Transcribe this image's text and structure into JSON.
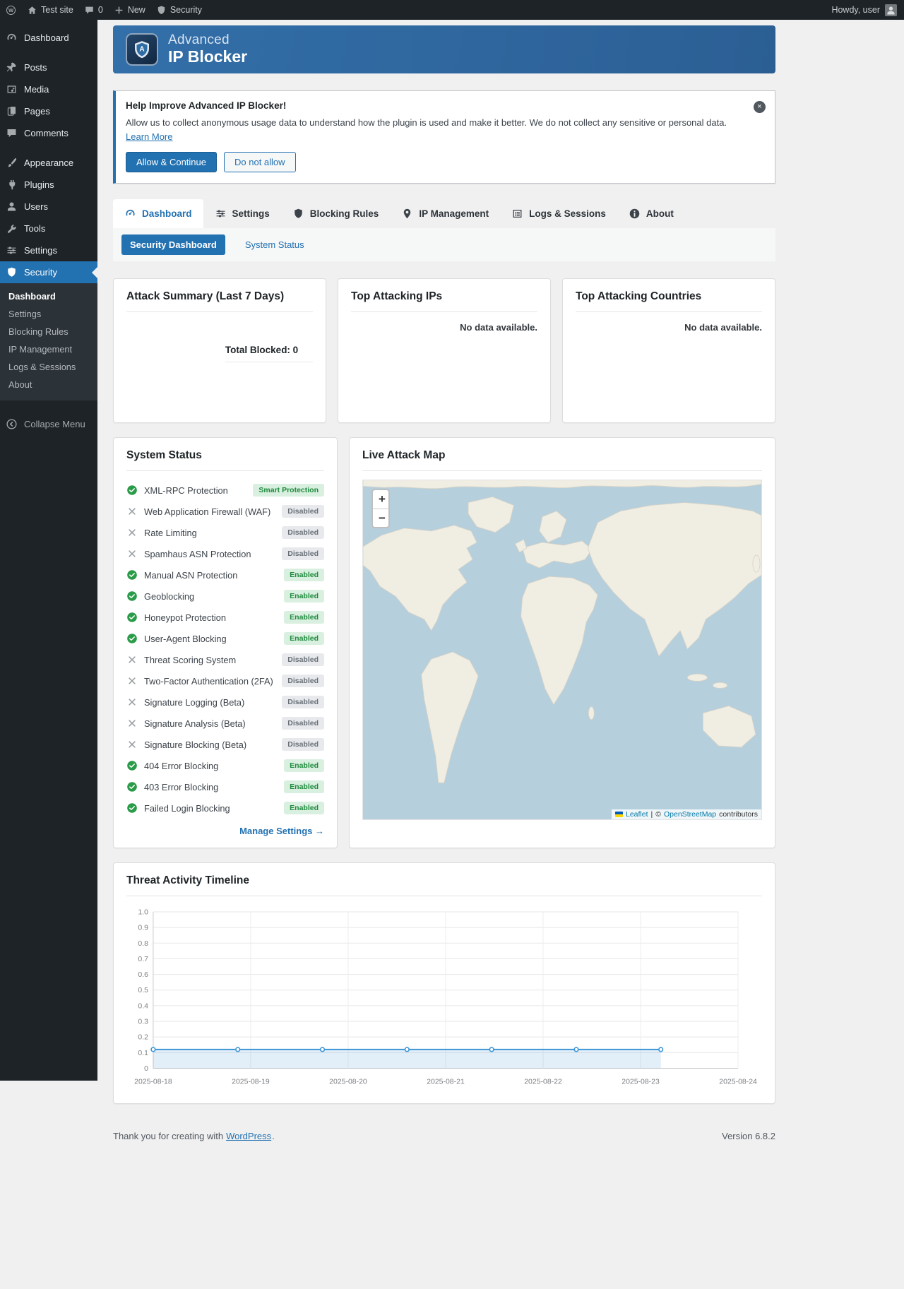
{
  "colors": {
    "accent": "#2271b1",
    "sidebar_bg": "#1d2327",
    "enabled_badge_bg": "#d9efdf",
    "enabled_badge_text": "#1e8a3d",
    "disabled_badge_bg": "#e7e9ec",
    "disabled_badge_text": "#687078",
    "map_water": "#b6cfdd",
    "map_land": "#f0ede3"
  },
  "admin_bar": {
    "site_name": "Test site",
    "comments_count": "0",
    "new_label": "New",
    "security_label": "Security",
    "howdy": "Howdy, user"
  },
  "sidebar": {
    "items": [
      {
        "label": "Dashboard",
        "icon": "dashboard-icon"
      },
      {
        "label": "Posts",
        "icon": "pin-icon",
        "gap": true
      },
      {
        "label": "Media",
        "icon": "media-icon"
      },
      {
        "label": "Pages",
        "icon": "pages-icon"
      },
      {
        "label": "Comments",
        "icon": "comments-icon"
      },
      {
        "label": "Appearance",
        "icon": "appearance-icon",
        "gap": true
      },
      {
        "label": "Plugins",
        "icon": "plugin-icon"
      },
      {
        "label": "Users",
        "icon": "users-icon"
      },
      {
        "label": "Tools",
        "icon": "tools-icon"
      },
      {
        "label": "Settings",
        "icon": "sliders-icon"
      },
      {
        "label": "Security",
        "icon": "shield-icon",
        "active": true
      }
    ],
    "security_submenu": [
      {
        "label": "Dashboard",
        "current": true
      },
      {
        "label": "Settings"
      },
      {
        "label": "Blocking Rules"
      },
      {
        "label": "IP Management"
      },
      {
        "label": "Logs & Sessions"
      },
      {
        "label": "About"
      }
    ],
    "collapse_label": "Collapse Menu"
  },
  "plugin_header": {
    "title_top": "Advanced",
    "title_bottom": "IP Blocker",
    "logo_letter": "A"
  },
  "notice": {
    "title": "Help Improve Advanced IP Blocker!",
    "body": "Allow us to collect anonymous usage data to understand how the plugin is used and make it better. We do not collect any sensitive or personal data.",
    "learn_more": "Learn More",
    "allow_button": "Allow & Continue",
    "deny_button": "Do not allow",
    "dismiss": "×"
  },
  "tabs": [
    {
      "label": "Dashboard",
      "icon": "dashboard-icon",
      "active": true
    },
    {
      "label": "Settings",
      "icon": "sliders-icon"
    },
    {
      "label": "Blocking Rules",
      "icon": "shield-icon"
    },
    {
      "label": "IP Management",
      "icon": "location-icon"
    },
    {
      "label": "Logs & Sessions",
      "icon": "logs-icon"
    },
    {
      "label": "About",
      "icon": "info-icon"
    }
  ],
  "subtabs": [
    {
      "label": "Security Dashboard",
      "active": true
    },
    {
      "label": "System Status"
    }
  ],
  "attack_summary": {
    "title": "Attack Summary (Last 7 Days)",
    "total_label": "Total Blocked: 0"
  },
  "top_ips": {
    "title": "Top Attacking IPs",
    "empty": "No data available."
  },
  "top_countries": {
    "title": "Top Attacking Countries",
    "empty": "No data available."
  },
  "system_status": {
    "title": "System Status",
    "items": [
      {
        "label": "XML-RPC Protection",
        "badge": "Smart Protection",
        "state": "smart"
      },
      {
        "label": "Web Application Firewall (WAF)",
        "badge": "Disabled",
        "state": "disabled"
      },
      {
        "label": "Rate Limiting",
        "badge": "Disabled",
        "state": "disabled"
      },
      {
        "label": "Spamhaus ASN Protection",
        "badge": "Disabled",
        "state": "disabled"
      },
      {
        "label": "Manual ASN Protection",
        "badge": "Enabled",
        "state": "enabled"
      },
      {
        "label": "Geoblocking",
        "badge": "Enabled",
        "state": "enabled"
      },
      {
        "label": "Honeypot Protection",
        "badge": "Enabled",
        "state": "enabled"
      },
      {
        "label": "User-Agent Blocking",
        "badge": "Enabled",
        "state": "enabled"
      },
      {
        "label": "Threat Scoring System",
        "badge": "Disabled",
        "state": "disabled"
      },
      {
        "label": "Two-Factor Authentication (2FA)",
        "badge": "Disabled",
        "state": "disabled"
      },
      {
        "label": "Signature Logging (Beta)",
        "badge": "Disabled",
        "state": "disabled"
      },
      {
        "label": "Signature Analysis (Beta)",
        "badge": "Disabled",
        "state": "disabled"
      },
      {
        "label": "Signature Blocking (Beta)",
        "badge": "Disabled",
        "state": "disabled"
      },
      {
        "label": "404 Error Blocking",
        "badge": "Enabled",
        "state": "enabled"
      },
      {
        "label": "403 Error Blocking",
        "badge": "Enabled",
        "state": "enabled"
      },
      {
        "label": "Failed Login Blocking",
        "badge": "Enabled",
        "state": "enabled"
      }
    ],
    "manage_label": "Manage Settings →"
  },
  "attack_map": {
    "title": "Live Attack Map",
    "zoom_in": "+",
    "zoom_out": "−",
    "attribution_leaflet": "Leaflet",
    "attribution_sep": "|",
    "attribution_copy": "©",
    "attribution_osm": "OpenStreetMap",
    "attribution_contributors": "contributors"
  },
  "chart_data": {
    "type": "line",
    "title": "Threat Activity Timeline",
    "x": [
      "2025-08-18",
      "2025-08-19",
      "2025-08-20",
      "2025-08-21",
      "2025-08-22",
      "2025-08-23",
      "2025-08-24"
    ],
    "series": [
      {
        "name": "Threat Activity",
        "values": [
          0.12,
          0.12,
          0.12,
          0.12,
          0.12,
          0.12,
          0.12
        ]
      }
    ],
    "ylim": [
      0,
      1
    ],
    "y_tick_step": 0.1,
    "grid": true,
    "legend": "none",
    "line_end_fraction": 0.868,
    "line_color": "#3e95d6",
    "fill_color": "rgba(62,149,214,0.15)"
  },
  "footer": {
    "thanks_prefix": "Thank you for creating with",
    "wordpress": "WordPress",
    "suffix": ".",
    "version": "Version 6.8.2"
  }
}
